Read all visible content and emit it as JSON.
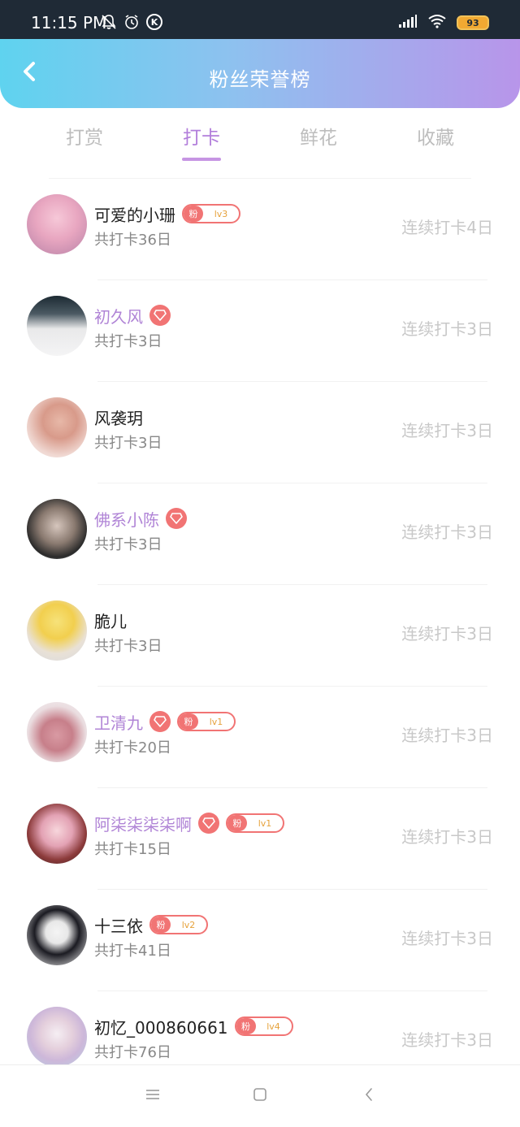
{
  "status_bar": {
    "time": "11:15 PM",
    "icons_left": [
      "bell-off-icon",
      "alarm-icon",
      "k-icon"
    ],
    "k_label": "K",
    "battery": "93"
  },
  "header": {
    "title": "粉丝荣誉榜",
    "back_icon": "chevron-left-icon",
    "gradient": [
      "#5fd3ef",
      "#b895ea"
    ]
  },
  "tabs": [
    {
      "label": "打赏",
      "active": false
    },
    {
      "label": "打卡",
      "active": true
    },
    {
      "label": "鲜花",
      "active": false
    },
    {
      "label": "收藏",
      "active": false
    }
  ],
  "colors": {
    "accent": "#b27edb",
    "badge": "#f17474",
    "vip_name": "#b084d6"
  },
  "fan_badge_label": "粉",
  "users": [
    {
      "name": "可爱的小珊",
      "vip": false,
      "fan_level": "lv3",
      "total": "共打卡36日",
      "streak": "连续打卡4日"
    },
    {
      "name": "初久风",
      "vip": true,
      "fan_level": null,
      "total": "共打卡3日",
      "streak": "连续打卡3日"
    },
    {
      "name": "风袭玥",
      "vip": false,
      "fan_level": null,
      "total": "共打卡3日",
      "streak": "连续打卡3日"
    },
    {
      "name": "佛系小陈",
      "vip": true,
      "fan_level": null,
      "total": "共打卡3日",
      "streak": "连续打卡3日"
    },
    {
      "name": "脆儿",
      "vip": false,
      "fan_level": null,
      "total": "共打卡3日",
      "streak": "连续打卡3日"
    },
    {
      "name": "卫清九",
      "vip": true,
      "fan_level": "lv1",
      "total": "共打卡20日",
      "streak": "连续打卡3日"
    },
    {
      "name": "阿柒柒柒柒啊",
      "vip": true,
      "fan_level": "lv1",
      "total": "共打卡15日",
      "streak": "连续打卡3日"
    },
    {
      "name": "十三依",
      "vip": false,
      "fan_level": "lv2",
      "total": "共打卡41日",
      "streak": "连续打卡3日"
    },
    {
      "name": "初忆_000860661",
      "vip": false,
      "fan_level": "lv4",
      "total": "共打卡76日",
      "streak": "连续打卡3日"
    }
  ],
  "nav_bar": {
    "icons": [
      "menu-icon",
      "home-square-icon",
      "back-icon"
    ]
  }
}
